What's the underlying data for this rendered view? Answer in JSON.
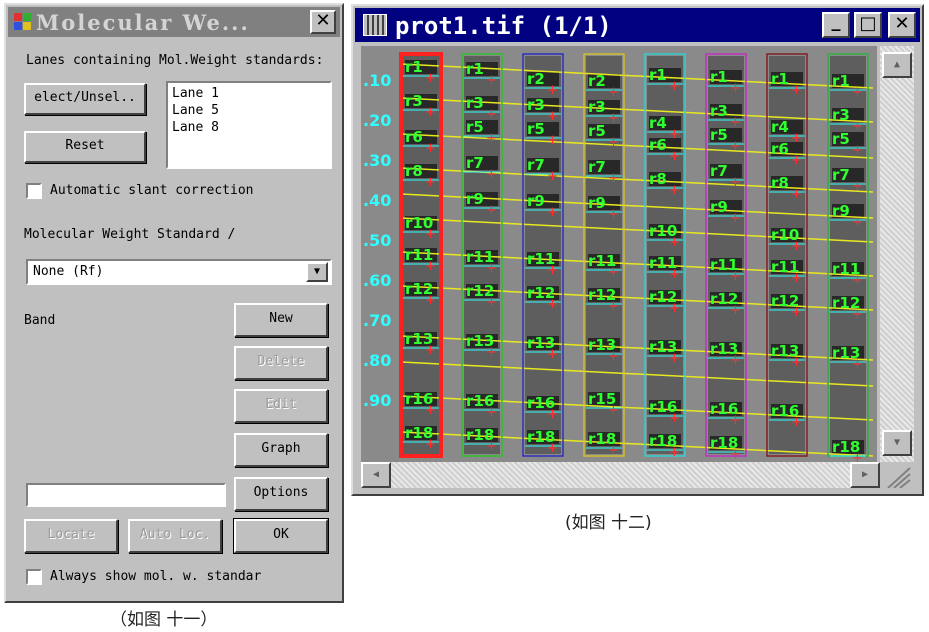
{
  "dialog": {
    "title": "Molecular We...",
    "close_label": "✕",
    "lanes_label": "Lanes containing Mol.Weight standards:",
    "select_button": "elect/Unsel..",
    "reset_button": "Reset",
    "lanes": [
      "Lane 1",
      "Lane 5",
      "Lane 8"
    ],
    "auto_slant_label": "Automatic slant correction",
    "mw_standard_label": "Molecular Weight Standard /",
    "mw_standard_value": "None (Rf)",
    "band_label": "Band",
    "new_button": "New",
    "delete_button": "Delete",
    "edit_button": "Edit",
    "graph_button": "Graph",
    "options_button": "Options",
    "locate_button": "Locate",
    "autoloc_button": "Auto Loc.",
    "ok_button": "OK",
    "always_show_label": "Always show mol. w. standar",
    "band_value": ""
  },
  "caption_left": "（如图 十一）",
  "image_window": {
    "title": "prot1.tif  (1/1)",
    "min_label": "_",
    "max_label": "□",
    "close_label": "✕"
  },
  "caption_right": "(如图 十二)",
  "gel": {
    "rf_labels": [
      ".10",
      ".20",
      ".30",
      ".40",
      ".50",
      ".60",
      ".70",
      ".80",
      ".90"
    ],
    "lanes": [
      {
        "color": "#ff2020",
        "bands": [
          "r1",
          "r3",
          "r6",
          "r8",
          "r10",
          "r11",
          "r12",
          "r13",
          "r16",
          "r18"
        ]
      },
      {
        "color": "#30c030",
        "bands": [
          "r1",
          "r3",
          "r5",
          "r7",
          "r9",
          "r11",
          "r12",
          "r13",
          "r16",
          "r18"
        ]
      },
      {
        "color": "#3030c0",
        "bands": [
          "r2",
          "r3",
          "r5",
          "r7",
          "r9",
          "r11",
          "r12",
          "r13",
          "r16",
          "r18"
        ]
      },
      {
        "color": "#d0c030",
        "bands": [
          "r2",
          "r3",
          "r5",
          "r7",
          "r9",
          "r11",
          "r12",
          "r13",
          "r15",
          "r18"
        ]
      },
      {
        "color": "#30d0d0",
        "bands": [
          "r1",
          "r4",
          "r6",
          "r8",
          "r10",
          "r11",
          "r12",
          "r13",
          "r16",
          "r18"
        ]
      },
      {
        "color": "#c030c0",
        "bands": [
          "r1",
          "r3",
          "r5",
          "r7",
          "r9",
          "r11",
          "r12",
          "r13",
          "r16",
          "r18"
        ]
      },
      {
        "color": "#802020",
        "bands": [
          "r1",
          "r4",
          "r6",
          "r8",
          "r10",
          "r11",
          "r12",
          "r13",
          "r16"
        ]
      },
      {
        "color": "#30b040",
        "bands": [
          "r1",
          "r3",
          "r5",
          "r7",
          "r9",
          "r11",
          "r12",
          "r13",
          "r18"
        ]
      }
    ]
  },
  "colors": {
    "band_label": "#30ff30",
    "rf_label": "#30ffff",
    "track_line": "#e8e820",
    "marker": "#ff3030"
  }
}
